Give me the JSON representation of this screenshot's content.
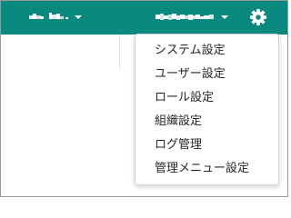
{
  "colors": {
    "header_bg": "#0a8a7e",
    "header_text": "#ffffff",
    "menu_text": "#262626",
    "menu_bg": "#ffffff"
  },
  "header": {
    "left_menu": {
      "label_obscured": true,
      "icon": "chevron-down-icon"
    },
    "user_menu": {
      "label_obscured": true,
      "icon": "chevron-down-icon"
    },
    "settings": {
      "icon": "gear-icon"
    }
  },
  "dropdown": {
    "items": [
      {
        "label": "システム設定"
      },
      {
        "label": "ユーザー設定"
      },
      {
        "label": "ロール設定"
      },
      {
        "label": "組織設定"
      },
      {
        "label": "ログ管理"
      },
      {
        "label": "管理メニュー設定"
      }
    ]
  }
}
